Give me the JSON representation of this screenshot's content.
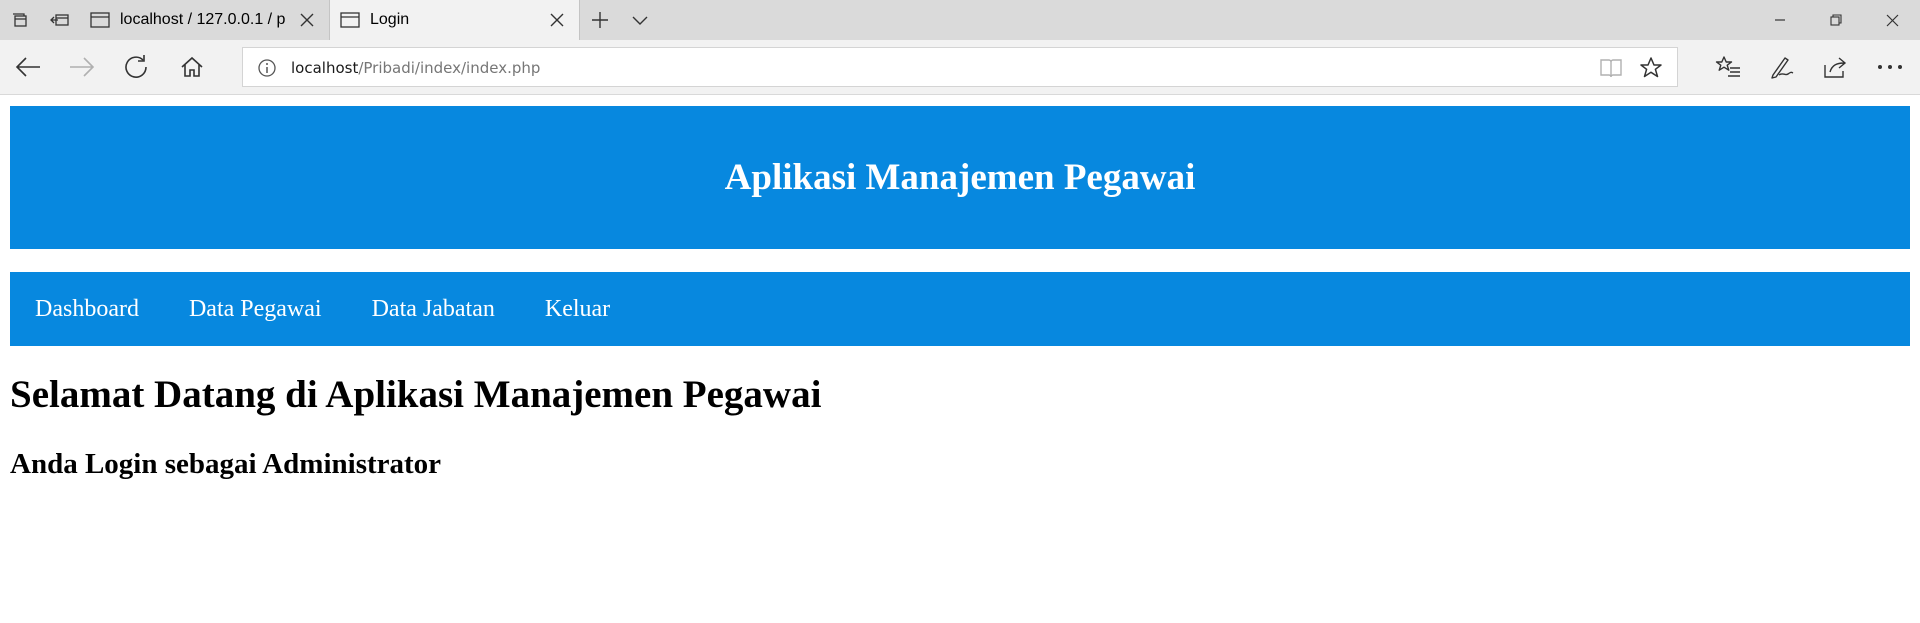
{
  "browser": {
    "tabs": [
      {
        "title": "localhost / 127.0.0.1 / p",
        "active": false
      },
      {
        "title": "Login",
        "active": true
      }
    ],
    "address": {
      "host": "localhost",
      "path": "/Pribadi/index/index.php"
    }
  },
  "page": {
    "header_title": "Aplikasi Manajemen Pegawai",
    "menu": [
      {
        "label": "Dashboard"
      },
      {
        "label": "Data Pegawai"
      },
      {
        "label": "Data Jabatan"
      },
      {
        "label": "Keluar"
      }
    ],
    "welcome": "Selamat Datang di Aplikasi Manajemen Pegawai",
    "role": "Anda Login sebagai Administrator"
  },
  "colors": {
    "header_bg": "#0788df",
    "tabbar_bg": "#dadada",
    "toolbar_bg": "#f2f2f2"
  },
  "icons": [
    "tab-set-aside-icon",
    "tabs-aside-icon",
    "page-icon",
    "close-icon",
    "new-tab-icon",
    "tab-preview-icon",
    "minimize-icon",
    "restore-icon",
    "back-icon",
    "forward-icon",
    "refresh-icon",
    "home-icon",
    "info-icon",
    "reading-view-icon",
    "favorite-star-icon",
    "favorites-list-icon",
    "pen-icon",
    "share-icon",
    "more-icon"
  ]
}
